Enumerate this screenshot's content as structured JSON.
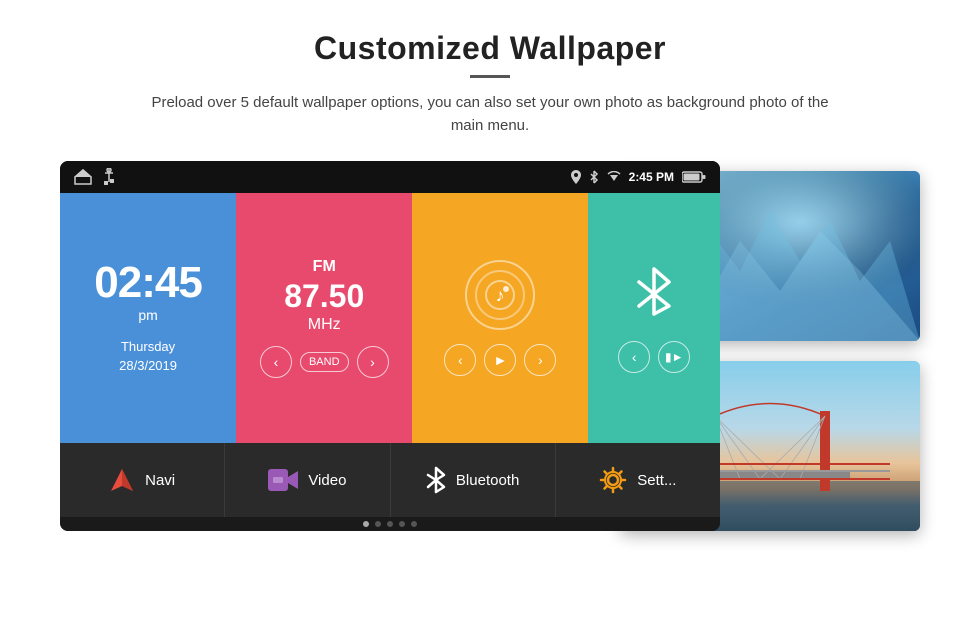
{
  "page": {
    "title": "Customized Wallpaper",
    "title_underline": true,
    "subtitle": "Preload over 5 default wallpaper options, you can also set your own photo as background photo of the main menu."
  },
  "status_bar": {
    "time": "2:45 PM",
    "icons": [
      "location-pin",
      "bluetooth",
      "wifi",
      "battery"
    ]
  },
  "clock_widget": {
    "time": "02:45",
    "ampm": "pm",
    "day": "Thursday",
    "date": "28/3/2019"
  },
  "fm_widget": {
    "label": "FM",
    "frequency": "87.50",
    "unit": "MHz",
    "band_label": "BAND"
  },
  "music_widget": {
    "icon": "♪"
  },
  "bluetooth_widget": {
    "icon": "⚡"
  },
  "nav_items": [
    {
      "id": "navi",
      "label": "Navi",
      "icon_type": "navi"
    },
    {
      "id": "video",
      "label": "Video",
      "icon_type": "video"
    },
    {
      "id": "bluetooth",
      "label": "Bluetooth",
      "icon_type": "bluetooth"
    },
    {
      "id": "settings",
      "label": "Sett...",
      "icon_type": "settings"
    }
  ],
  "dots": [
    1,
    2,
    3,
    4,
    5
  ],
  "active_dot": 1,
  "colors": {
    "clock_bg": "#4a90d9",
    "fm_bg": "#e84a6e",
    "music_bg": "#f5a623",
    "bt_bg": "#3dbfa8",
    "nav_bg": "#2a2a2a",
    "screen_bg": "#1a1a1a"
  }
}
